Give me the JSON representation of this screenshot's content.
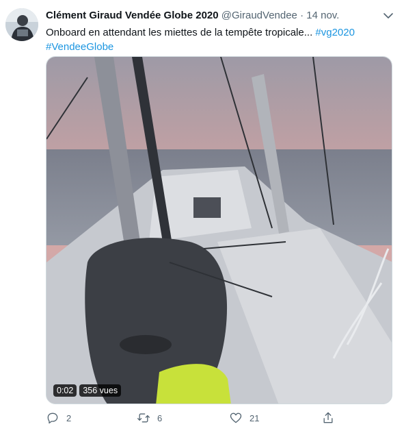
{
  "tweet": {
    "author_name": "Clément Giraud Vendée Globe 2020",
    "handle": "@GiraudVendee",
    "separator": "·",
    "time": "14 nov.",
    "text_main": "Onboard en attendant les miettes de la tempête tropicale... ",
    "hashtag_1": "#vg2020",
    "hashtag_2": "#VendeeGlobe"
  },
  "video": {
    "duration": "0:02",
    "views": "356 vues"
  },
  "actions": {
    "replies": "2",
    "retweets": "6",
    "likes": "21",
    "share": ""
  },
  "colors": {
    "link": "#1b95e0",
    "muted": "#536471",
    "border": "#cfd9de"
  }
}
